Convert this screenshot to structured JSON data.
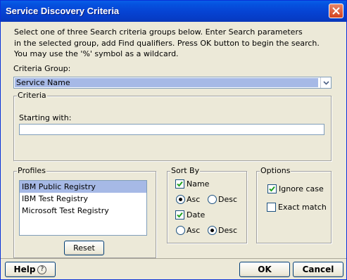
{
  "window": {
    "title": "Service Discovery Criteria"
  },
  "intro": {
    "lines": [
      "Select one of three Search criteria groups below. Enter Search parameters",
      "in the selected group, add Find qualifiers. Press OK button to begin the search.",
      "You may use the '%' symbol as a wildcard."
    ]
  },
  "criteria_group": {
    "label": "Criteria Group:",
    "selected": "Service Name"
  },
  "criteria": {
    "legend": "Criteria",
    "starting_with_label": "Starting with:",
    "starting_with_value": ""
  },
  "profiles": {
    "legend": "Profiles",
    "items": [
      "IBM Public Registry",
      "IBM Test Registry",
      "Microsoft Test Registry"
    ],
    "selected_index": 0,
    "reset_label": "Reset"
  },
  "sort_by": {
    "legend": "Sort By",
    "name": {
      "label": "Name",
      "checked": true,
      "asc_label": "Asc",
      "desc_label": "Desc",
      "order": "Asc"
    },
    "date": {
      "label": "Date",
      "checked": true,
      "asc_label": "Asc",
      "desc_label": "Desc",
      "order": "Desc"
    }
  },
  "options": {
    "legend": "Options",
    "ignore_case": {
      "label": "Ignore case",
      "checked": true
    },
    "exact_match": {
      "label": "Exact match",
      "checked": false
    }
  },
  "footer": {
    "help_label": "Help",
    "help_icon": "?",
    "ok_label": "OK",
    "cancel_label": "Cancel"
  },
  "colors": {
    "titlebar": "#0644d4",
    "window_bg": "#ece9d8",
    "selection": "#a6b9e6",
    "border": "#7f9db9"
  }
}
